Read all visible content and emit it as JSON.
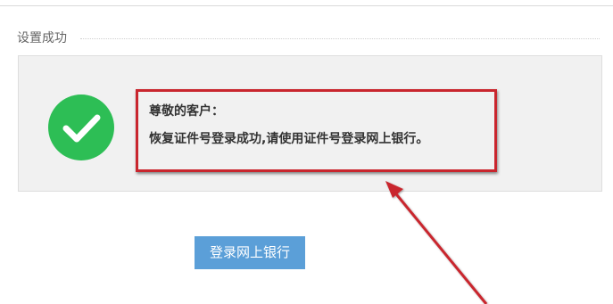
{
  "section": {
    "title": "设置成功"
  },
  "notice": {
    "greeting": "尊敬的客户：",
    "message": "恢复证件号登录成功,请使用证件号登录网上银行。"
  },
  "actions": {
    "login_label": "登录网上银行"
  },
  "colors": {
    "success": "#2dbe55",
    "highlight": "#c9262e",
    "button": "#5b9fd8",
    "panel": "#f1f1f1"
  },
  "icons": {
    "status": "check-circle-icon",
    "annotation": "red-arrow-icon"
  }
}
